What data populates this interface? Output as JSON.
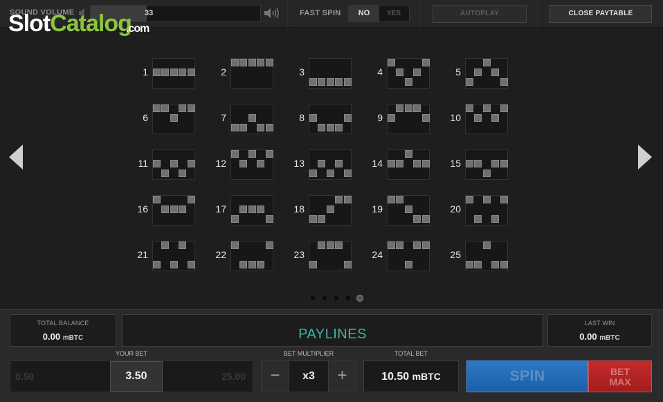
{
  "top_bar": {
    "sound_volume_label": "SOUND VOLUME",
    "sound_volume_value": "33",
    "sound_volume_level": 0.33,
    "fast_spin_label": "FAST SPIN",
    "fast_spin_no": "NO",
    "fast_spin_yes": "YES",
    "autoplay_label": "AUTOPLAY",
    "close_paytable_label": "CLOSE PAYTABLE"
  },
  "logo": {
    "part1": "Slot",
    "part2": "Catalog",
    "suffix": ".com",
    "color_text": "#ffffff",
    "color_accent": "#8bc53f"
  },
  "paylines": [
    {
      "num": "1",
      "pattern": [
        1,
        1,
        1,
        1,
        1
      ]
    },
    {
      "num": "2",
      "pattern": [
        0,
        0,
        0,
        0,
        0
      ]
    },
    {
      "num": "3",
      "pattern": [
        2,
        2,
        2,
        2,
        2
      ]
    },
    {
      "num": "4",
      "pattern": [
        0,
        1,
        2,
        1,
        0
      ]
    },
    {
      "num": "5",
      "pattern": [
        2,
        1,
        0,
        1,
        2
      ]
    },
    {
      "num": "6",
      "pattern": [
        0,
        0,
        1,
        0,
        0
      ]
    },
    {
      "num": "7",
      "pattern": [
        2,
        2,
        1,
        2,
        2
      ]
    },
    {
      "num": "8",
      "pattern": [
        1,
        2,
        2,
        2,
        1
      ]
    },
    {
      "num": "9",
      "pattern": [
        1,
        0,
        0,
        0,
        1
      ]
    },
    {
      "num": "10",
      "pattern": [
        0,
        1,
        0,
        1,
        0
      ]
    },
    {
      "num": "11",
      "pattern": [
        1,
        2,
        1,
        2,
        1
      ]
    },
    {
      "num": "12",
      "pattern": [
        0,
        1,
        0,
        1,
        0
      ]
    },
    {
      "num": "13",
      "pattern": [
        2,
        1,
        2,
        1,
        2
      ]
    },
    {
      "num": "14",
      "pattern": [
        1,
        1,
        0,
        1,
        1
      ]
    },
    {
      "num": "15",
      "pattern": [
        1,
        1,
        2,
        1,
        1
      ]
    },
    {
      "num": "16",
      "pattern": [
        0,
        1,
        1,
        1,
        0
      ]
    },
    {
      "num": "17",
      "pattern": [
        2,
        1,
        1,
        1,
        2
      ]
    },
    {
      "num": "18",
      "pattern": [
        2,
        2,
        1,
        0,
        0
      ]
    },
    {
      "num": "19",
      "pattern": [
        0,
        0,
        1,
        2,
        2
      ]
    },
    {
      "num": "20",
      "pattern": [
        0,
        2,
        0,
        2,
        0
      ]
    },
    {
      "num": "21",
      "pattern": [
        2,
        0,
        2,
        0,
        2
      ]
    },
    {
      "num": "22",
      "pattern": [
        0,
        2,
        2,
        2,
        0
      ]
    },
    {
      "num": "23",
      "pattern": [
        2,
        0,
        0,
        0,
        2
      ]
    },
    {
      "num": "24",
      "pattern": [
        0,
        0,
        2,
        0,
        0
      ]
    },
    {
      "num": "25",
      "pattern": [
        2,
        2,
        0,
        2,
        2
      ]
    }
  ],
  "pagination": {
    "count": 5,
    "active": 5
  },
  "bottom": {
    "total_balance_label": "TOTAL BALANCE",
    "total_balance_value": "0.00",
    "total_balance_unit": "mBTC",
    "message": "PAYLINES",
    "last_win_label": "LAST WIN",
    "last_win_value": "0.00",
    "last_win_unit": "mBTC",
    "your_bet_label": "YOUR BET",
    "bet_min": "0.50",
    "bet_value": "3.50",
    "bet_max": "25.00",
    "bet_multiplier_label": "BET MULTIPLIER",
    "multiplier_value": "x3",
    "minus_label": "−",
    "plus_label": "+",
    "total_bet_label": "TOTAL BET",
    "total_bet_value": "10.50",
    "total_bet_unit": "mBTC",
    "spin_label": "SPIN",
    "bet_max_line1": "BET",
    "bet_max_line2": "MAX",
    "message_color": "#3fb5a0",
    "spin_color": "#2b79c7",
    "bet_max_color": "#c42b2b"
  }
}
